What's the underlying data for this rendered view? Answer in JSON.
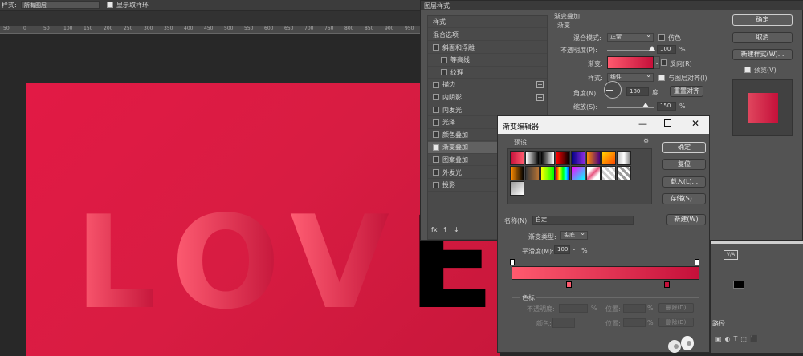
{
  "optbar": {
    "style_label": "样式:",
    "style_value": "所有图层",
    "show_sampling_label": "显示取样环"
  },
  "ruler": {
    "ticks": [
      "50",
      "0",
      "50",
      "100",
      "150",
      "200",
      "250",
      "300",
      "350",
      "400",
      "450",
      "500",
      "550",
      "600",
      "650",
      "700",
      "750",
      "800",
      "850",
      "900",
      "950"
    ]
  },
  "document": {
    "letters": [
      "L",
      "O",
      "V"
    ],
    "letter_e": "E"
  },
  "layer_style": {
    "title": "图层样式",
    "left_header": "样式",
    "blend_options": "混合选项",
    "items": [
      {
        "label": "斜面和浮雕",
        "checked": false,
        "indent": false,
        "plus": false,
        "selected": false
      },
      {
        "label": "等高线",
        "checked": false,
        "indent": true,
        "plus": false,
        "selected": false
      },
      {
        "label": "纹理",
        "checked": false,
        "indent": true,
        "plus": false,
        "selected": false
      },
      {
        "label": "描边",
        "checked": false,
        "indent": false,
        "plus": true,
        "selected": false
      },
      {
        "label": "内阴影",
        "checked": false,
        "indent": false,
        "plus": true,
        "selected": false
      },
      {
        "label": "内发光",
        "checked": false,
        "indent": false,
        "plus": false,
        "selected": false
      },
      {
        "label": "光泽",
        "checked": false,
        "indent": false,
        "plus": false,
        "selected": false
      },
      {
        "label": "颜色叠加",
        "checked": false,
        "indent": false,
        "plus": true,
        "selected": false
      },
      {
        "label": "渐变叠加",
        "checked": true,
        "indent": false,
        "plus": true,
        "selected": true
      },
      {
        "label": "图案叠加",
        "checked": false,
        "indent": false,
        "plus": false,
        "selected": false
      },
      {
        "label": "外发光",
        "checked": false,
        "indent": false,
        "plus": false,
        "selected": false
      },
      {
        "label": "投影",
        "checked": false,
        "indent": false,
        "plus": true,
        "selected": false
      }
    ],
    "bottom_icons": [
      "fx",
      "↑",
      "↓"
    ],
    "section_title": "渐变叠加",
    "subsection": "渐变",
    "blend_mode_label": "混合模式:",
    "blend_mode_value": "正常",
    "dither_label": "仿色",
    "opacity_label": "不透明度(P):",
    "opacity_value": "100",
    "opacity_unit": "%",
    "gradient_label": "渐变:",
    "reverse_label": "反向(R)",
    "style_label": "样式:",
    "style_value": "线性",
    "align_label": "与图层对齐(I)",
    "angle_label": "角度(N):",
    "angle_value": "180",
    "angle_unit": "度",
    "reset_align": "重置对齐",
    "scale_label": "缩放(S):",
    "scale_value": "150",
    "scale_unit": "%",
    "ok": "确定",
    "cancel": "取消",
    "new_style": "新建样式(W)...",
    "preview_label": "预览(V)"
  },
  "gradient_editor": {
    "title": "渐变编辑器",
    "presets_label": "预设",
    "gear": "⚙",
    "ok": "确定",
    "reset": "复位",
    "load": "载入(L)...",
    "save": "存储(S)...",
    "name_label": "名称(N):",
    "name_value": "自定",
    "new_button": "新建(W)",
    "type_label": "渐变类型:",
    "type_value": "实底",
    "smooth_label": "平滑度(M):",
    "smooth_value": "100",
    "smooth_unit": "%",
    "stops_section": "色标",
    "opacity_label": "不透明度:",
    "pct": "%",
    "position_label": "位置:",
    "delete_label": "删除(D)",
    "color_label": "颜色:",
    "position2_label": "位置:",
    "delete2_label": "删除(D)",
    "colors": {
      "start": "#ff5a6e",
      "end": "#c5103a"
    }
  },
  "right_panel": {
    "paths_label": "路径"
  },
  "colors": {
    "doc_bg": "#e21a45",
    "accent_gradient_start": "#ff5e73",
    "accent_gradient_end": "#c4153a"
  }
}
